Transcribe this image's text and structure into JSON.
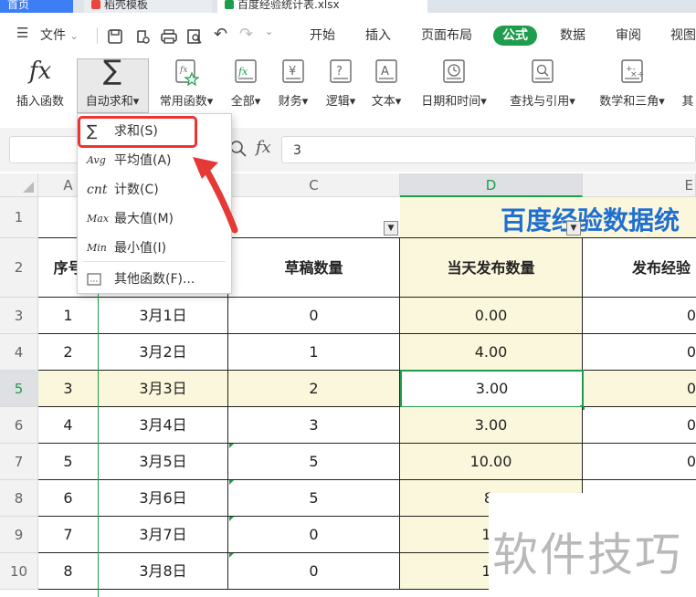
{
  "tabs": [
    {
      "label": "首页"
    },
    {
      "label": "稻壳模板"
    },
    {
      "label": "百度经验统计表.xlsx"
    }
  ],
  "menubar": {
    "file_label": "文件",
    "items": [
      {
        "label": "开始"
      },
      {
        "label": "插入"
      },
      {
        "label": "页面布局"
      },
      {
        "label": "公式"
      },
      {
        "label": "数据"
      },
      {
        "label": "审阅"
      },
      {
        "label": "视图"
      }
    ],
    "active_tab": "公式"
  },
  "ribbon": {
    "buttons": [
      {
        "label": "插入函数",
        "icon": "fx-icon"
      },
      {
        "label": "自动求和▾",
        "icon": "sigma-icon"
      },
      {
        "label": "常用函数▾",
        "icon": "star-fx-icon"
      },
      {
        "label": "全部▾",
        "icon": "fx-box-icon"
      },
      {
        "label": "财务▾",
        "icon": "yen-book-icon"
      },
      {
        "label": "逻辑▾",
        "icon": "question-book-icon"
      },
      {
        "label": "文本▾",
        "icon": "a-book-icon"
      },
      {
        "label": "日期和时间▾",
        "icon": "clock-book-icon"
      },
      {
        "label": "查找与引用▾",
        "icon": "search-book-icon"
      },
      {
        "label": "数学和三角▾",
        "icon": "math-book-icon"
      },
      {
        "label": "其",
        "icon": ""
      }
    ]
  },
  "formula_bar": {
    "fx": "fx",
    "value": "3"
  },
  "dropdown": {
    "items": [
      {
        "icon": "sigma-icon",
        "glyph": "∑",
        "label": "求和(S)"
      },
      {
        "icon": "avg-icon",
        "glyph": "Avg",
        "label": "平均值(A)"
      },
      {
        "icon": "cnt-icon",
        "glyph": "cnt",
        "label": "计数(C)"
      },
      {
        "icon": "max-icon",
        "glyph": "Max",
        "label": "最大值(M)"
      },
      {
        "icon": "min-icon",
        "glyph": "Min",
        "label": "最小值(I)"
      },
      {
        "icon": "more-functions-icon",
        "glyph": "",
        "label": "其他函数(F)..."
      }
    ],
    "highlight_color": "#e33333"
  },
  "sheet": {
    "col_headers": [
      "A",
      "C",
      "D",
      "E"
    ],
    "row_numbers": [
      "1",
      "2",
      "3",
      "4",
      "5",
      "6",
      "7",
      "8",
      "9",
      "10"
    ],
    "title": "百度经验数据统",
    "headers": {
      "a": "序号",
      "c": "草稿数量",
      "d": "当天发布数量",
      "e": "发布经验"
    },
    "rows": [
      {
        "a": "1",
        "b": "3月1日",
        "c": "0",
        "d": "0.00",
        "e": "0"
      },
      {
        "a": "2",
        "b": "3月2日",
        "c": "1",
        "d": "4.00",
        "e": "0"
      },
      {
        "a": "3",
        "b": "3月3日",
        "c": "2",
        "d": "3.00",
        "e": "0"
      },
      {
        "a": "4",
        "b": "3月4日",
        "c": "3",
        "d": "3.00",
        "e": "0"
      },
      {
        "a": "5",
        "b": "3月5日",
        "c": "5",
        "d": "10.00",
        "e": "0"
      },
      {
        "a": "6",
        "b": "3月6日",
        "c": "5",
        "d": "8.",
        "e": ""
      },
      {
        "a": "7",
        "b": "3月7日",
        "c": "0",
        "d": "13",
        "e": ""
      },
      {
        "a": "8",
        "b": "3月8日",
        "c": "0",
        "d": "10",
        "e": ""
      }
    ],
    "accent_color": "#1e9d4e",
    "highlight_fill": "#fbf7dc"
  },
  "watermark": {
    "text": "软件技巧"
  }
}
